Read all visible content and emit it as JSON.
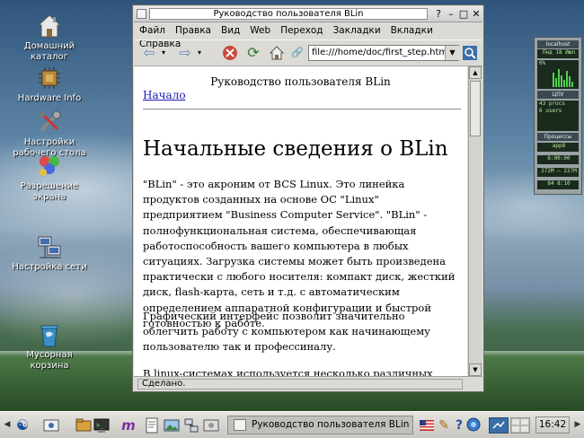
{
  "desktop": {
    "icons": [
      {
        "label": "Домашний каталог",
        "icon": "home-folder-icon"
      },
      {
        "label": "Hardware Info",
        "icon": "chip-icon"
      },
      {
        "label": "Настройки рабочего стола",
        "icon": "tools-icon"
      },
      {
        "label": "Разрешение экрана",
        "icon": "display-resolution-icon"
      },
      {
        "label": "Настройка сети",
        "icon": "network-icon"
      },
      {
        "label": "Мусорная корзина",
        "icon": "trash-icon"
      }
    ]
  },
  "window": {
    "title": "Руководство пользователя BLin",
    "menu": [
      {
        "label": "Файл"
      },
      {
        "label": "Правка"
      },
      {
        "label": "Вид"
      },
      {
        "label": "Web"
      },
      {
        "label": "Переход"
      },
      {
        "label": "Закладки"
      },
      {
        "label": "Вкладки"
      },
      {
        "label": "Справка"
      }
    ],
    "url": "file:///home/doc/first_step.html",
    "status": "Сделано."
  },
  "page": {
    "header": "Руководство пользователя BLin",
    "home_link": "Начало",
    "heading": "Начальные сведения о BLin",
    "p1": "\"BLin\" - это акроним от BCS Linux. Это линейка продуктов созданных на основе ОС \"Linux\" предприятием \"Business Computer Service\". \"BLin\" - полнофункциональная система, обеспечивающая работоспособность вашего компьютера в любых ситуациях. Загрузка системы может быть произведена практически с любого носителя: компакт диск, жесткий диск, flash-карта, сеть и т.д. с автоматическим определением аппаратной конфигурации и быстрой готовностью к работе.",
    "p2": "Графический интерфейс позволит значительно облегчить работу с компьютером как начинающему пользователю так и профессиналу.",
    "p3": "В linux-системах используется несколько различных программ,"
  },
  "monitor": {
    "host": "localhost",
    "date": "Пнд 18 Июл",
    "cpu_pct": "0%",
    "cpu_label": "ЦПУ",
    "procs": "43 procs",
    "users": "6 users",
    "procs_label": "Процессы",
    "apps": "app8",
    "t1": "6:00:00",
    "mem": "272M – 227M",
    "mem_pct": "0%",
    "t2": "84 8:10"
  },
  "taskbar": {
    "task_title": "Руководство пользователя BLin",
    "clock": "16:42"
  }
}
